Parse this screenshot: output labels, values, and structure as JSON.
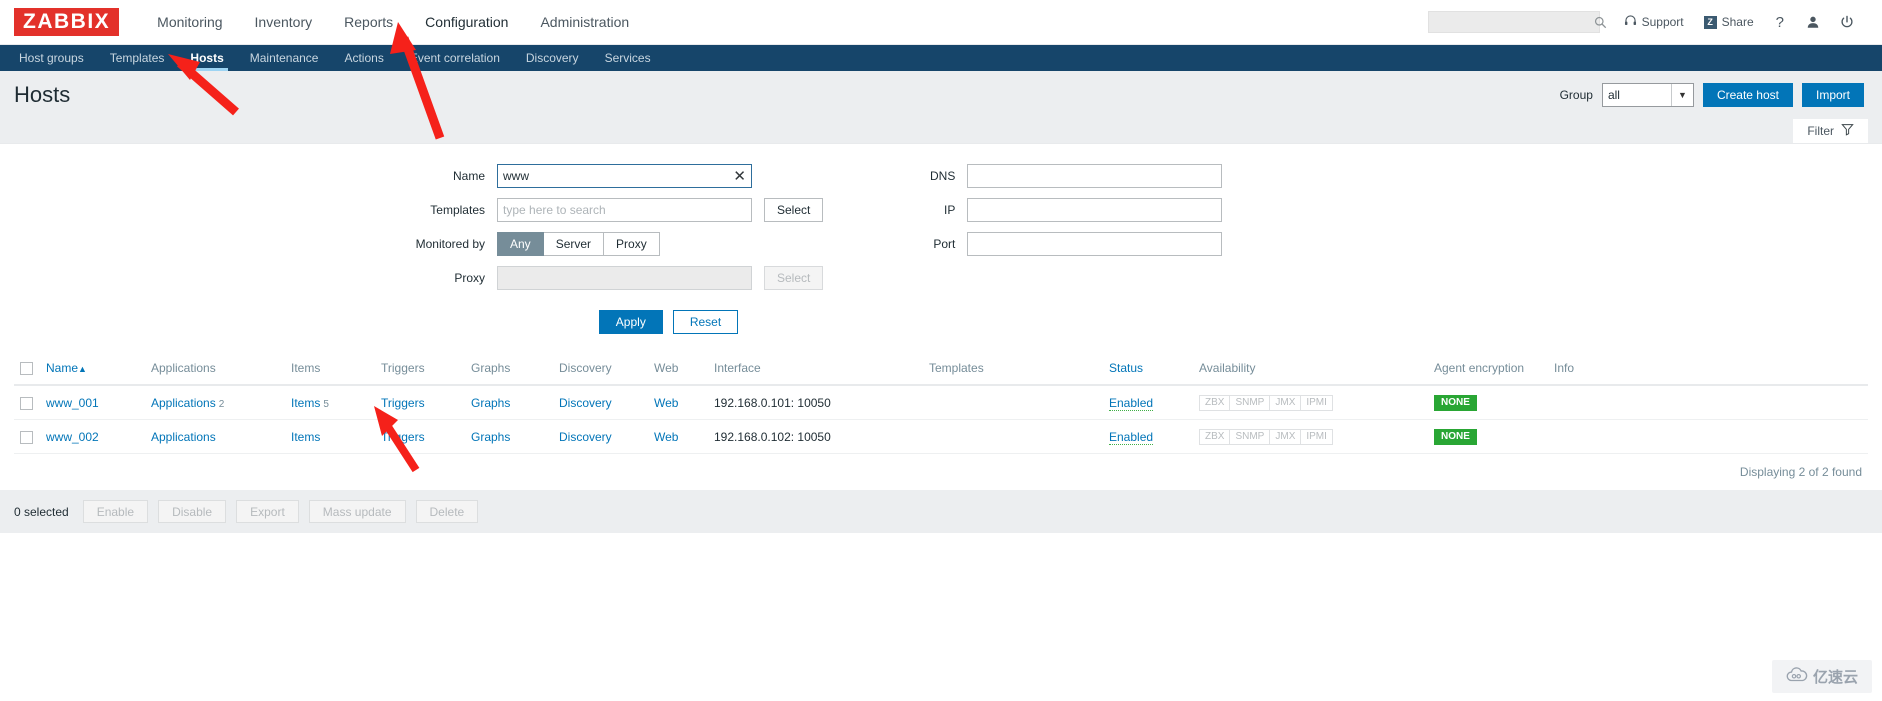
{
  "header": {
    "logo": "ZABBIX",
    "nav": [
      {
        "label": "Monitoring",
        "selected": false
      },
      {
        "label": "Inventory",
        "selected": false
      },
      {
        "label": "Reports",
        "selected": false
      },
      {
        "label": "Configuration",
        "selected": true
      },
      {
        "label": "Administration",
        "selected": false
      }
    ],
    "search_placeholder": "",
    "search_value": "",
    "support_label": "Support",
    "share_label": "Share",
    "share_icon_letter": "Z",
    "help_label": "?",
    "user_icon": "user-icon",
    "signout_icon": "power-icon"
  },
  "subnav": {
    "items": [
      {
        "label": "Host groups",
        "selected": false
      },
      {
        "label": "Templates",
        "selected": false
      },
      {
        "label": "Hosts",
        "selected": true
      },
      {
        "label": "Maintenance",
        "selected": false
      },
      {
        "label": "Actions",
        "selected": false
      },
      {
        "label": "Event correlation",
        "selected": false
      },
      {
        "label": "Discovery",
        "selected": false
      },
      {
        "label": "Services",
        "selected": false
      }
    ]
  },
  "pagehead": {
    "title": "Hosts",
    "group_label": "Group",
    "group_value": "all",
    "create_host_label": "Create host",
    "import_label": "Import"
  },
  "filter_tab": {
    "label": "Filter",
    "icon": "filter-icon"
  },
  "filter": {
    "name_label": "Name",
    "name_value": "www",
    "templates_label": "Templates",
    "templates_value": "",
    "templates_placeholder": "type here to search",
    "templates_select_label": "Select",
    "monitored_by_label": "Monitored by",
    "monitored_by_options": [
      "Any",
      "Server",
      "Proxy"
    ],
    "monitored_by_selected": "Any",
    "proxy_label": "Proxy",
    "proxy_value": "",
    "proxy_select_label": "Select",
    "dns_label": "DNS",
    "dns_value": "",
    "ip_label": "IP",
    "ip_value": "",
    "port_label": "Port",
    "port_value": "",
    "apply_label": "Apply",
    "reset_label": "Reset"
  },
  "table": {
    "columns": [
      "Name",
      "Applications",
      "Items",
      "Triggers",
      "Graphs",
      "Discovery",
      "Web",
      "Interface",
      "Templates",
      "Status",
      "Availability",
      "Agent encryption",
      "Info"
    ],
    "sort_column": "Name",
    "sort_dir": "asc",
    "availability_badges": [
      "ZBX",
      "SNMP",
      "JMX",
      "IPMI"
    ],
    "rows": [
      {
        "name": "www_001",
        "applications": "Applications",
        "applications_count": "2",
        "items": "Items",
        "items_count": "5",
        "triggers": "Triggers",
        "triggers_count": "",
        "graphs": "Graphs",
        "graphs_count": "",
        "discovery": "Discovery",
        "discovery_count": "",
        "web": "Web",
        "interface": "192.168.0.101: 10050",
        "templates": "",
        "status": "Enabled",
        "agent_encryption": "NONE",
        "info": ""
      },
      {
        "name": "www_002",
        "applications": "Applications",
        "applications_count": "",
        "items": "Items",
        "items_count": "",
        "triggers": "Triggers",
        "triggers_count": "",
        "graphs": "Graphs",
        "graphs_count": "",
        "discovery": "Discovery",
        "discovery_count": "",
        "web": "Web",
        "interface": "192.168.0.102: 10050",
        "templates": "",
        "status": "Enabled",
        "agent_encryption": "NONE",
        "info": ""
      }
    ],
    "displaying": "Displaying 2 of 2 found"
  },
  "footer": {
    "selected_count": "0 selected",
    "buttons": [
      "Enable",
      "Disable",
      "Export",
      "Mass update",
      "Delete"
    ]
  },
  "watermark": {
    "text": "亿速云",
    "icon": "cloud-icon"
  },
  "colors": {
    "brand_red": "#e3312a",
    "nav_dark": "#16456a",
    "accent_blue": "#0275b8",
    "link_blue": "#0275b8",
    "status_green": "#3faf46",
    "badge_green": "#29a634",
    "annotation_red": "#f5211a"
  }
}
